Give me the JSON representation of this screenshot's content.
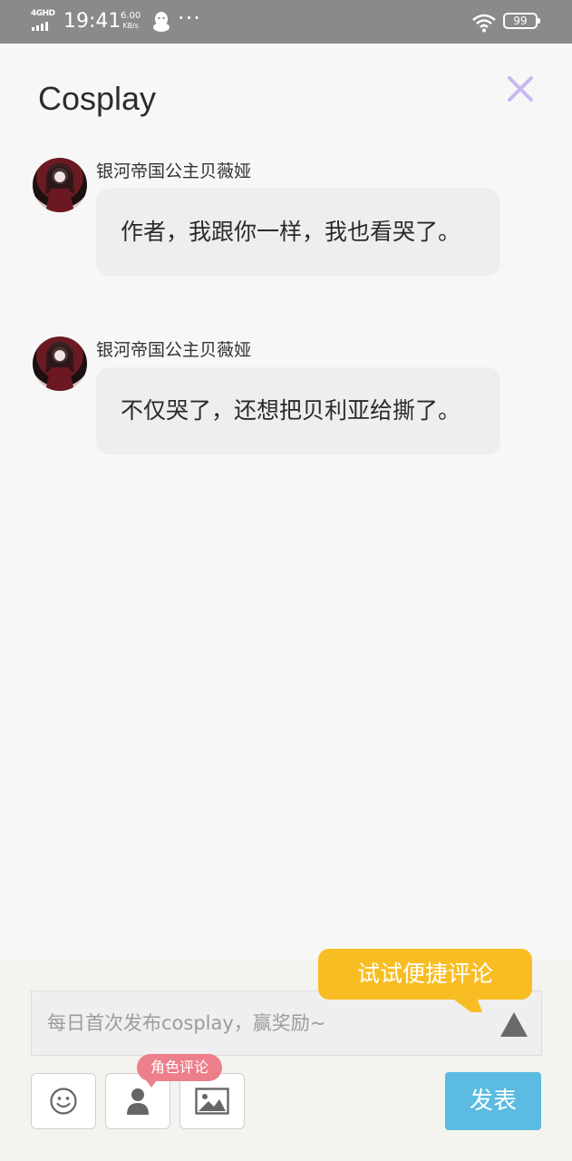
{
  "status_bar": {
    "network": "4GHD",
    "time": "19:41",
    "speed_value": "6.00",
    "speed_unit": "KB/s",
    "more": "···",
    "battery": "99"
  },
  "header": {
    "title": "Cosplay",
    "close_icon": "close-icon",
    "close_color": "#c9b8f0"
  },
  "messages": [
    {
      "author": "银河帝国公主贝薇娅",
      "text": "作者，我跟你一样，我也看哭了。"
    },
    {
      "author": "银河帝国公主贝薇娅",
      "text": "不仅哭了，还想把贝利亚给撕了。"
    }
  ],
  "composer": {
    "placeholder": "每日首次发布cosplay，赢奖励~",
    "tooltip": "试试便捷评论",
    "role_tag": "角色评论",
    "publish_label": "发表",
    "tools": [
      "emoji-icon",
      "person-icon",
      "image-icon"
    ],
    "tooltip_color": "#f8bd22",
    "publish_color": "#5bbbe0",
    "role_tag_color": "#ec7f8b"
  }
}
